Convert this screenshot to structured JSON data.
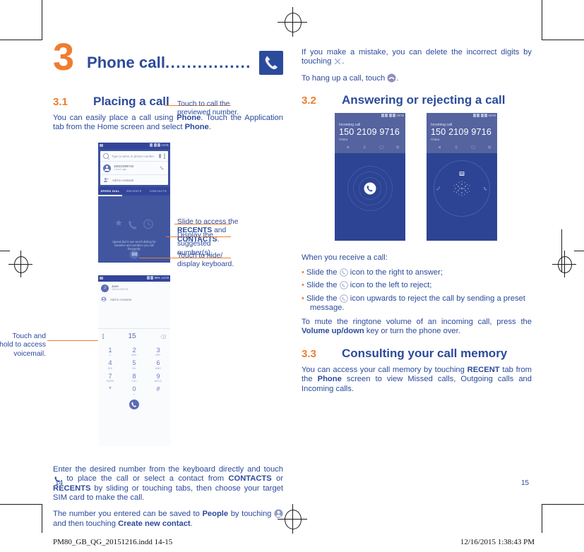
{
  "chapter": {
    "number": "3",
    "title": "Phone call",
    "dots": "................",
    "icon": "phone-handset-icon"
  },
  "sections": {
    "s31": {
      "num": "3.1",
      "title": "Placing a call"
    },
    "s32": {
      "num": "3.2",
      "title": "Answering or rejecting a call"
    },
    "s33": {
      "num": "3.3",
      "title": "Consulting your call memory"
    }
  },
  "left_column": {
    "intro_1": "You can easily place a call using ",
    "intro_1_b1": "Phone",
    "intro_1_mid": ". Touch the Application tab from the Home screen and select ",
    "intro_1_b2": "Phone",
    "intro_1_end": ".",
    "para_enter_1": "Enter the desired number from the keyboard directly and touch",
    "para_enter_2": " to place the call or select a contact from ",
    "para_enter_b1": "CONTACTS",
    "para_enter_3": " or ",
    "para_enter_b2": "RECENTS",
    "para_enter_4": " by sliding or touching tabs, then choose your target SIM card to make the call.",
    "para_save_1": "The number you entered can be saved to ",
    "para_save_b1": "People",
    "para_save_2": " by touching ",
    "para_save_3": " and then touching ",
    "para_save_b2": "Create new contact",
    "para_save_4": "."
  },
  "annotations": {
    "call_preview": "Touch to call the previewed number.",
    "slide_access_1": "Slide to access the ",
    "slide_access_b1": "RECENTS",
    "slide_access_2": " and ",
    "slide_access_b2": "CONTACTS",
    "slide_access_3": ".",
    "hide_keyboard": "Touch to hide/ display keyboard.",
    "suggested": "Display the suggested number(s).",
    "voicemail": "Touch and hold to access voicemail."
  },
  "phone_mock_1": {
    "status_time": "14:01",
    "search_placeholder": "Type a name or phone number",
    "contact_number": "15021099716",
    "contact_meta": "1 hour ago",
    "add_contacts": "Add to contacts",
    "tabs": [
      "SPEED DIAL",
      "RECENTS",
      "CONTACTS"
    ],
    "active_tab": "SPEED DIAL",
    "speed_dial_hint": "Speed dial is one touch dialing for favorites and numbers you call frequently."
  },
  "phone_mock_2": {
    "status_time": "14:03",
    "status_battery": "99%",
    "contact_name": "Jane",
    "contact_number": "15021099716",
    "add_contacts": "Add to contacts",
    "dialed": "15",
    "keys": [
      {
        "digit": "1",
        "letters": "∞"
      },
      {
        "digit": "2",
        "letters": "ABC"
      },
      {
        "digit": "3",
        "letters": "DEF"
      },
      {
        "digit": "4",
        "letters": "GHI"
      },
      {
        "digit": "5",
        "letters": "JKL"
      },
      {
        "digit": "6",
        "letters": "MNO"
      },
      {
        "digit": "7",
        "letters": "PQRS"
      },
      {
        "digit": "8",
        "letters": "TUV"
      },
      {
        "digit": "9",
        "letters": "WXYZ"
      },
      {
        "digit": "*",
        "letters": ""
      },
      {
        "digit": "0",
        "letters": "+"
      },
      {
        "digit": "#",
        "letters": ""
      }
    ]
  },
  "right_column": {
    "mistake_1": "If you make a mistake, you can delete the incorrect digits by touching",
    "mistake_2": ".",
    "hangup_1": "To hang up a call, touch",
    "hangup_2": ".",
    "receive_intro": "When you receive a call:",
    "bullets": [
      {
        "pre": "Slide the ",
        "post": " icon to the right to answer;"
      },
      {
        "pre": "Slide the ",
        "post": " icon to the left to reject;"
      },
      {
        "pre": "Slide the ",
        "post": " icon upwards to reject the call by sending a preset message."
      }
    ],
    "mute_1": "To mute the ringtone volume of an incoming call, press the ",
    "mute_b1": "Volume up/down",
    "mute_2": " key or turn the phone over.",
    "memory_1": "You can access your call memory by touching ",
    "memory_b1": "RECENT",
    "memory_2": " tab from the ",
    "memory_b2": "Phone",
    "memory_3": " screen to view Missed calls, Outgoing calls and Incoming calls."
  },
  "incoming_call": {
    "label": "Incoming call",
    "number": "150 2109 9716",
    "region": "China",
    "status_time": "16:02"
  },
  "page_numbers": {
    "left": "14",
    "right": "15"
  },
  "footer": {
    "file": "PM80_GB_QG_20151216.indd   14-15",
    "timestamp": "12/16/2015   1:38:43 PM"
  },
  "colors": {
    "brand_blue": "#2b4a9b",
    "accent_orange": "#f07c2e",
    "screen_blue": "#3c50a0",
    "incoming_blue": "#2c4493"
  }
}
